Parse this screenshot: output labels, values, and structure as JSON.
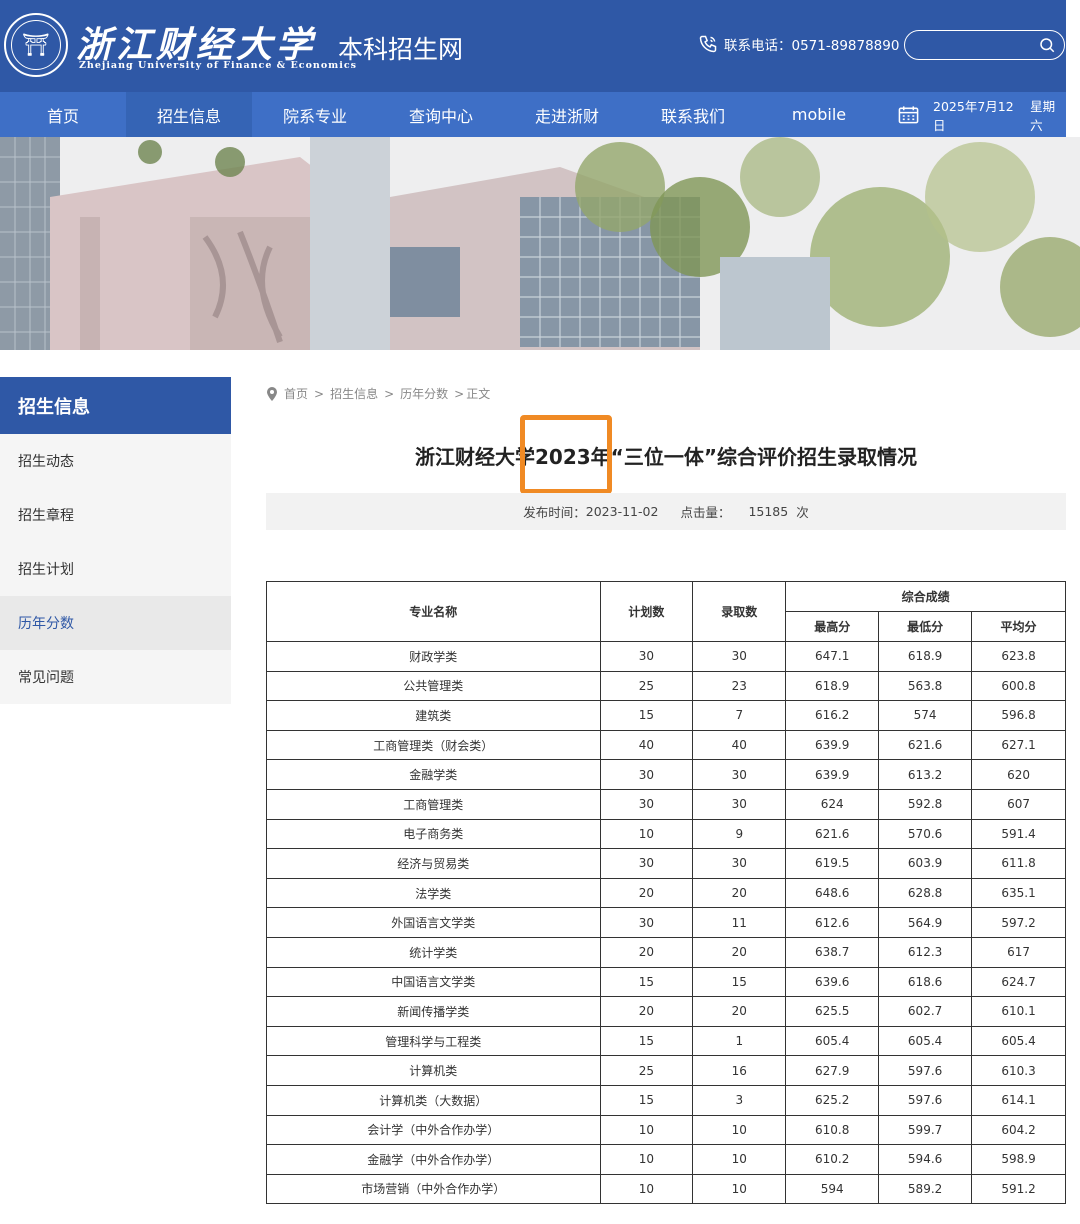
{
  "header": {
    "logo_cn": "浙江财经大学",
    "logo_en": "Zhejiang University of Finance & Economics",
    "site_title": "本科招生网",
    "phone_label": "联系电话：0571-89878890"
  },
  "nav": {
    "items": [
      "首页",
      "招生信息",
      "院系专业",
      "查询中心",
      "走进浙财",
      "联系我们",
      "mobile"
    ],
    "date": "2025年7月12日",
    "weekday": "星期六"
  },
  "sidebar": {
    "title": "招生信息",
    "items": [
      "招生动态",
      "招生章程",
      "招生计划",
      "历年分数",
      "常见问题"
    ]
  },
  "breadcrumb": [
    "首页",
    "招生信息",
    "历年分数",
    "正文"
  ],
  "article": {
    "title": "浙江财经大学2023年“三位一体”综合评价招生录取情况",
    "publish_label": "发布时间：",
    "publish_date": "2023-11-02",
    "clicks_label": "点击量：",
    "clicks": "15185",
    "clicks_unit": "次"
  },
  "table": {
    "headers": {
      "major": "专业名称",
      "plan": "计划数",
      "admit": "录取数",
      "composite": "综合成绩",
      "max": "最高分",
      "min": "最低分",
      "avg": "平均分"
    },
    "rows": [
      [
        "财政学类",
        "30",
        "30",
        "647.1",
        "618.9",
        "623.8"
      ],
      [
        "公共管理类",
        "25",
        "23",
        "618.9",
        "563.8",
        "600.8"
      ],
      [
        "建筑类",
        "15",
        "7",
        "616.2",
        "574",
        "596.8"
      ],
      [
        "工商管理类（财会类）",
        "40",
        "40",
        "639.9",
        "621.6",
        "627.1"
      ],
      [
        "金融学类",
        "30",
        "30",
        "639.9",
        "613.2",
        "620"
      ],
      [
        "工商管理类",
        "30",
        "30",
        "624",
        "592.8",
        "607"
      ],
      [
        "电子商务类",
        "10",
        "9",
        "621.6",
        "570.6",
        "591.4"
      ],
      [
        "经济与贸易类",
        "30",
        "30",
        "619.5",
        "603.9",
        "611.8"
      ],
      [
        "法学类",
        "20",
        "20",
        "648.6",
        "628.8",
        "635.1"
      ],
      [
        "外国语言文学类",
        "30",
        "11",
        "612.6",
        "564.9",
        "597.2"
      ],
      [
        "统计学类",
        "20",
        "20",
        "638.7",
        "612.3",
        "617"
      ],
      [
        "中国语言文学类",
        "15",
        "15",
        "639.6",
        "618.6",
        "624.7"
      ],
      [
        "新闻传播学类",
        "20",
        "20",
        "625.5",
        "602.7",
        "610.1"
      ],
      [
        "管理科学与工程类",
        "15",
        "1",
        "605.4",
        "605.4",
        "605.4"
      ],
      [
        "计算机类",
        "25",
        "16",
        "627.9",
        "597.6",
        "610.3"
      ],
      [
        "计算机类（大数据）",
        "15",
        "3",
        "625.2",
        "597.6",
        "614.1"
      ],
      [
        "会计学（中外合作办学）",
        "10",
        "10",
        "610.8",
        "599.7",
        "604.2"
      ],
      [
        "金融学（中外合作办学）",
        "10",
        "10",
        "610.2",
        "594.6",
        "598.9"
      ],
      [
        "市场营销（中外合作办学）",
        "10",
        "10",
        "594",
        "589.2",
        "591.2"
      ]
    ]
  },
  "colors": {
    "header_bg": "#2f58a6",
    "nav_bg": "#3e6fc6",
    "highlight": "#f08a24"
  }
}
